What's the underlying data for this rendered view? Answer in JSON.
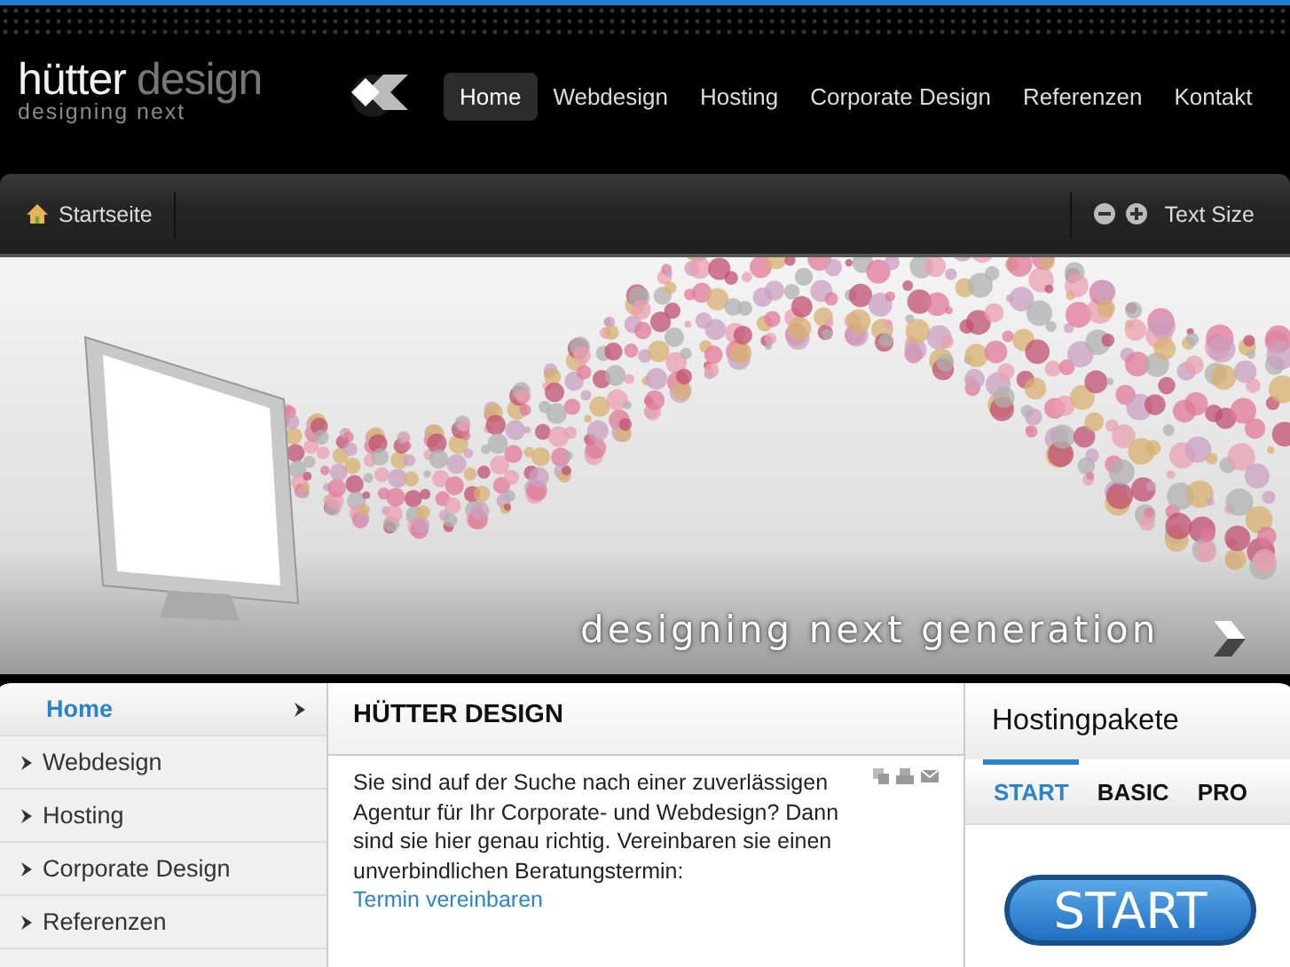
{
  "header": {
    "logo": {
      "word_1": "hütter",
      "word_2": "design",
      "tagline": "designing next"
    },
    "nav": [
      {
        "label": "Home",
        "selected": true
      },
      {
        "label": "Webdesign",
        "selected": false
      },
      {
        "label": "Hosting",
        "selected": false
      },
      {
        "label": "Corporate Design",
        "selected": false
      },
      {
        "label": "Referenzen",
        "selected": false
      },
      {
        "label": "Kontakt",
        "selected": false
      }
    ]
  },
  "breadcrumb": {
    "items": [
      "Startseite"
    ],
    "text_size": "Text Size"
  },
  "banner": {
    "slogan": "designing next generation"
  },
  "sidebar": {
    "items": [
      {
        "label": "Home",
        "selected": true
      },
      {
        "label": "Webdesign",
        "selected": false
      },
      {
        "label": "Hosting",
        "selected": false
      },
      {
        "label": "Corporate Design",
        "selected": false
      },
      {
        "label": "Referenzen",
        "selected": false
      }
    ]
  },
  "article": {
    "title": "HÜTTER DESIGN",
    "body": "Sie sind auf der Suche nach einer zuverlässigen Agentur für Ihr Corporate- und Webdesign? Dann sind sie hier genau richtig. Vereinbaren sie einen unverbindlichen Beratungstermin:",
    "link": "Termin vereinbaren"
  },
  "hosting": {
    "title": "Hostingpakete",
    "tabs": [
      {
        "label": "START",
        "selected": true
      },
      {
        "label": "BASIC",
        "selected": false
      },
      {
        "label": "PRO",
        "selected": false
      }
    ],
    "button": "START"
  }
}
